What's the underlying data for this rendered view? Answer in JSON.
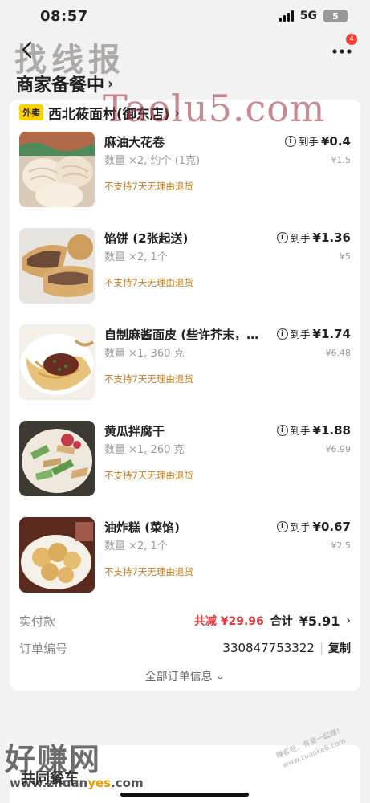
{
  "status": {
    "time": "08:57",
    "network": "5G",
    "battery": "5"
  },
  "nav": {
    "badge": "4",
    "back_icon": "chevron-left-icon",
    "more_icon": "ellipsis-icon"
  },
  "watermark": {
    "top": "找线报",
    "top2": "Taolu5.com",
    "bottom": "好赚网",
    "bottom_url_a": "www.zhuan",
    "bottom_url_b": "yes",
    "bottom_url_c": ".com",
    "stamp_a": "赚客吧，有奖一起赚！",
    "stamp_b": "www.zuanke8.com"
  },
  "page": {
    "title": "商家备餐中",
    "title_chev": "›"
  },
  "store": {
    "tag": "外卖",
    "name": "西北莜面村(御东店)",
    "chev": "›"
  },
  "items": [
    {
      "name": "麻油大花卷",
      "qty": "数量 ×2, 约个 (1克)",
      "policy": "不支持7天无理由退货",
      "final_label": "到手",
      "final": "¥0.4",
      "orig": "¥1.5"
    },
    {
      "name": "馅饼 (2张起送)",
      "qty": "数量 ×2, 1个",
      "policy": "不支持7天无理由退货",
      "final_label": "到手",
      "final": "¥1.36",
      "orig": "¥5"
    },
    {
      "name": "自制麻酱面皮 (些许芥末，…",
      "qty": "数量 ×1, 360 克",
      "policy": "不支持7天无理由退货",
      "final_label": "到手",
      "final": "¥1.74",
      "orig": "¥6.48"
    },
    {
      "name": "黄瓜拌腐干",
      "qty": "数量 ×1, 260 克",
      "policy": "不支持7天无理由退货",
      "final_label": "到手",
      "final": "¥1.88",
      "orig": "¥6.99"
    },
    {
      "name": "油炸糕 (菜馅)",
      "qty": "数量 ×2, 1个",
      "policy": "不支持7天无理由退货",
      "final_label": "到手",
      "final": "¥0.67",
      "orig": "¥2.5"
    }
  ],
  "summary": {
    "paid_label": "实付款",
    "discount": "共减 ¥29.96",
    "total_label": "合计",
    "total": "¥5.91",
    "total_chev": "›",
    "order_label": "订单编号",
    "order_no": "330847753322",
    "sep": "|",
    "copy": "复制",
    "all_info": "全部订单信息",
    "all_info_chev": "⌄"
  },
  "bottom": {
    "label": "共同餐车"
  },
  "colors": {
    "accent_red": "#e4393c",
    "policy_orange": "#c07b1e",
    "tag_yellow": "#ffd100"
  }
}
